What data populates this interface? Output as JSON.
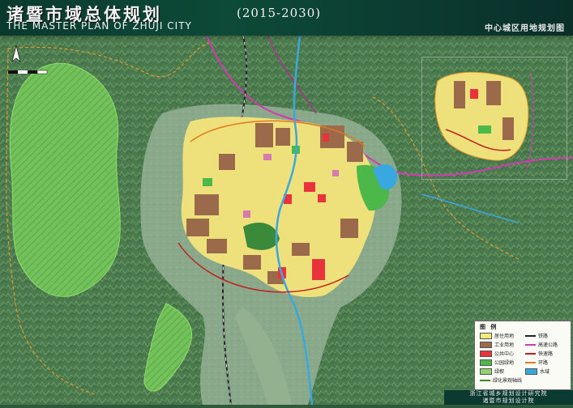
{
  "header": {
    "title_cn": "诸暨市域总体规划",
    "years": "(2015-2030)",
    "title_en": "THE MASTER PLAN OF ZHUJI CITY",
    "subtitle": "中心城区用地规划图"
  },
  "legend": {
    "title": "图 例",
    "items": [
      {
        "label": "居住用地",
        "color": "#f2ea7a",
        "kind": "fill"
      },
      {
        "label": "工业用地",
        "color": "#9a6a4a",
        "kind": "fill"
      },
      {
        "label": "公共中心",
        "color": "#e8333c",
        "kind": "fill"
      },
      {
        "label": "公园绿地",
        "color": "#4cb84a",
        "kind": "fill"
      },
      {
        "label": "绿楔",
        "color": "#8fd46e",
        "kind": "fill"
      },
      {
        "label": "绿化景观轴线",
        "color": "#3a8a2a",
        "kind": "line"
      },
      {
        "label": "铁路",
        "color": "#222222",
        "kind": "line"
      },
      {
        "label": "高速公路",
        "color": "#d23ab0",
        "kind": "line"
      },
      {
        "label": "快速路",
        "color": "#c02020",
        "kind": "line"
      },
      {
        "label": "环路",
        "color": "#e07a20",
        "kind": "line"
      },
      {
        "label": "水域",
        "color": "#3aa8e0",
        "kind": "fill"
      }
    ]
  },
  "footer": {
    "line1": "浙江省城乡规划设计研究院",
    "line2": "诸暨市规划设计院"
  },
  "colors": {
    "header_bg": "#0d4a38",
    "terrain": "#4f7e52",
    "residential": "#f2ea7a",
    "industrial": "#9a6a4a",
    "commercial": "#e8333c",
    "park": "#4cb84a",
    "water": "#3aa8e0"
  },
  "icons": [
    "north-arrow-icon",
    "scale-bar-icon"
  ]
}
